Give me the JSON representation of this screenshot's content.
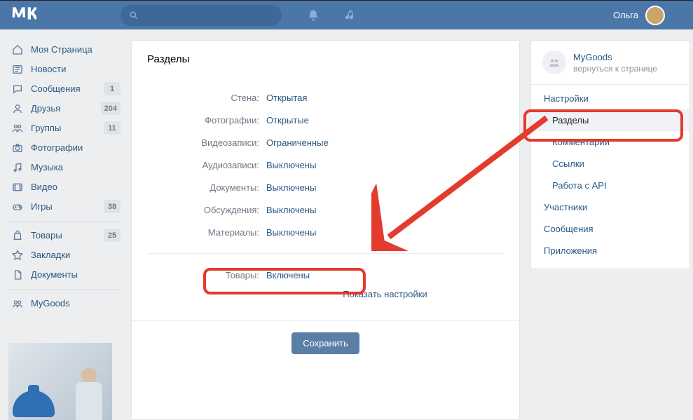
{
  "topbar": {
    "user_name": "Ольга"
  },
  "nav": {
    "items": [
      {
        "label": "Моя Страница",
        "icon": "home"
      },
      {
        "label": "Новости",
        "icon": "news"
      },
      {
        "label": "Сообщения",
        "icon": "chat",
        "badge": "1"
      },
      {
        "label": "Друзья",
        "icon": "friends",
        "badge": "204"
      },
      {
        "label": "Группы",
        "icon": "groups",
        "badge": "11"
      },
      {
        "label": "Фотографии",
        "icon": "camera"
      },
      {
        "label": "Музыка",
        "icon": "music"
      },
      {
        "label": "Видео",
        "icon": "video"
      },
      {
        "label": "Игры",
        "icon": "games",
        "badge": "38"
      }
    ],
    "items2": [
      {
        "label": "Товары",
        "icon": "goods",
        "badge": "25"
      },
      {
        "label": "Закладки",
        "icon": "star"
      },
      {
        "label": "Документы",
        "icon": "doc"
      }
    ],
    "items3": [
      {
        "label": "MyGoods",
        "icon": "group"
      }
    ]
  },
  "main": {
    "title": "Разделы",
    "rows": {
      "wall": {
        "label": "Стена:",
        "value": "Открытая"
      },
      "photos": {
        "label": "Фотографии:",
        "value": "Открытые"
      },
      "videos": {
        "label": "Видеозаписи:",
        "value": "Ограниченные"
      },
      "audio": {
        "label": "Аудиозаписи:",
        "value": "Выключены"
      },
      "docs": {
        "label": "Документы:",
        "value": "Выключены"
      },
      "discuss": {
        "label": "Обсуждения:",
        "value": "Выключены"
      },
      "material": {
        "label": "Материалы:",
        "value": "Выключены"
      },
      "goods": {
        "label": "Товары:",
        "value": "Включены"
      }
    },
    "show_settings_link": "Показать настройки",
    "save_button": "Сохранить"
  },
  "sidebar": {
    "group_name": "MyGoods",
    "back_link": "вернуться к странице",
    "items": [
      {
        "label": "Настройки",
        "level": 1
      },
      {
        "label": "Разделы",
        "level": 2,
        "active": true
      },
      {
        "label": "Комментарии",
        "level": 2
      },
      {
        "label": "Ссылки",
        "level": 2
      },
      {
        "label": "Работа с API",
        "level": 2
      },
      {
        "label": "Участники",
        "level": 1
      },
      {
        "label": "Сообщения",
        "level": 1
      },
      {
        "label": "Приложения",
        "level": 1
      }
    ]
  }
}
